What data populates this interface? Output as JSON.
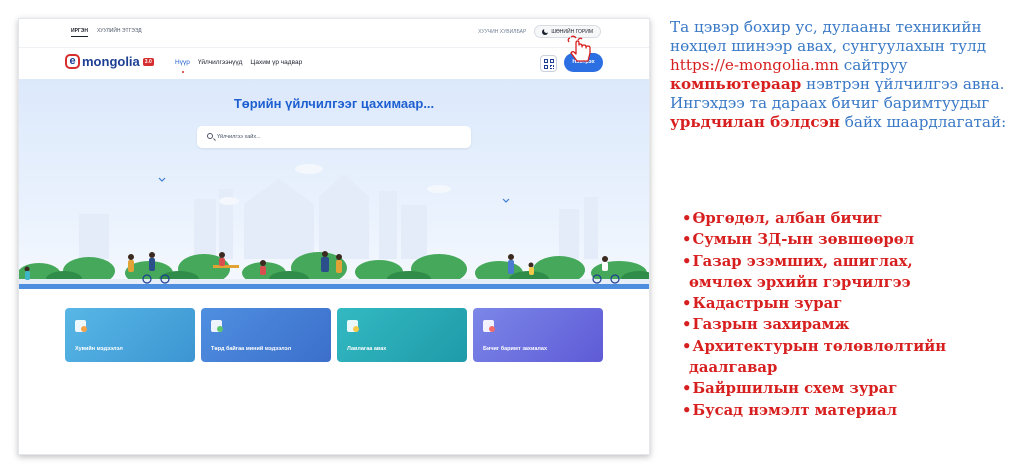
{
  "topbar": {
    "tab_citizen": "ИРГЭН",
    "tab_business": "ХУУЛИЙН ЭТГЭЭД",
    "personal_space": "ХУУЧИН ХУВИЛБАР",
    "dark_mode": "ШӨНИЙН ГОРИМ"
  },
  "logo": {
    "e": "e",
    "word": "mongolia",
    "version": "3.0"
  },
  "nav": {
    "items": [
      "Нүүр",
      "Үйлчилгээнүүд",
      "Цахим үр чадвар"
    ],
    "login": "Нэвтрэх"
  },
  "hero": {
    "title": "Төрийн үйлчилгээг цахимаар...",
    "search_placeholder": "Үйлчилгээ хайх..."
  },
  "cards": [
    {
      "label": "Хувийн мэдээлэл",
      "icon": "profile-card-icon"
    },
    {
      "label": "Төрд байгаа миний мэдээлэл",
      "icon": "document-list-icon"
    },
    {
      "label": "Лавлагаа авах",
      "icon": "certificate-icon"
    },
    {
      "label": "Бичиг баримт захиалах",
      "icon": "order-document-icon"
    }
  ],
  "panel": {
    "intro_1": "Та цэвэр бохир ус, дулааны техникийн нөхцөл шинээр авах, сунгуулахын тулд ",
    "site": "https://e-mongolia.mn",
    "intro_2": " сайтруу ",
    "computer": "компьютераар",
    "intro_3": " нэвтрэн  үйлчилгээ авна. Ингэхдээ та дараах бичиг баримтуудыг ",
    "prepared": "урьдчилан бэлдсэн",
    "intro_4": " байх шаардлагатай:",
    "docs": [
      "Өргөдөл, албан бичиг",
      "Сумын ЗД-ын зөвшөөрөл",
      "Газар эзэмших, ашиглах,",
      "өмчлөх эрхийн гэрчилгээ",
      "Кадастрын зураг",
      "Газрын захирамж",
      "Архитектурын төлөвлөлтийн",
      "даалгавар",
      "Байршилын схем зураг",
      "Бусад нэмэлт материал"
    ]
  },
  "colors": {
    "brand_blue": "#1d5fd1",
    "brand_red": "#d62e2e",
    "text_blue": "#3a79c6",
    "text_red": "#d81f1f"
  }
}
